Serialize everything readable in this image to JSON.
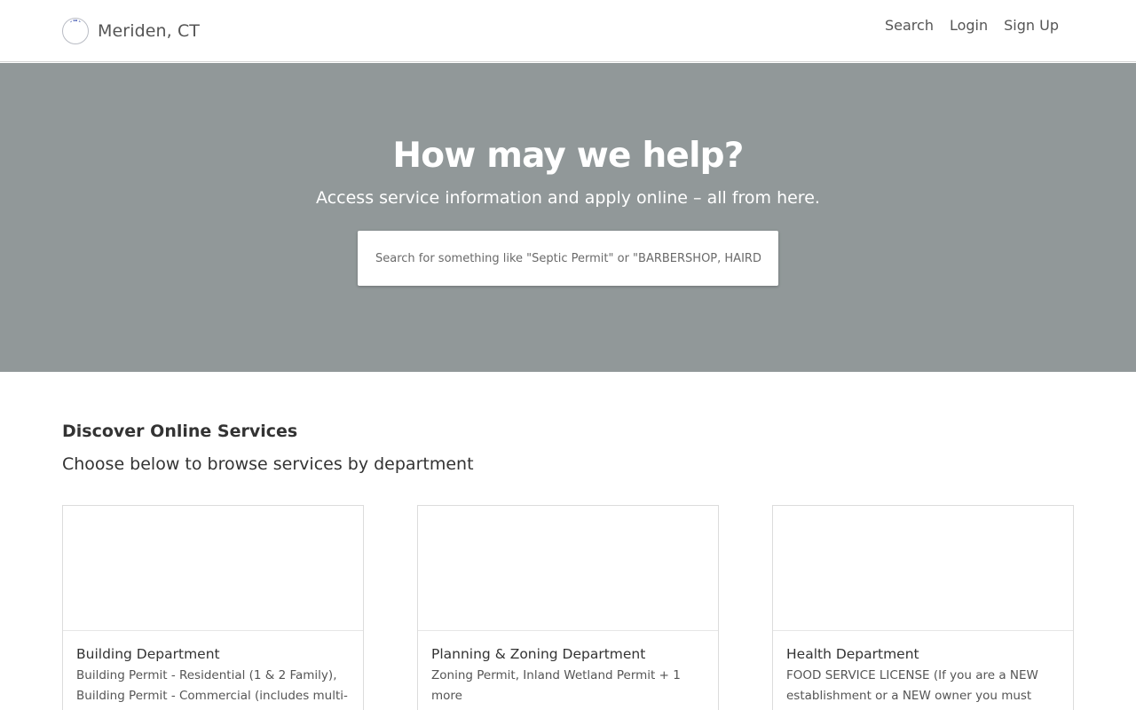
{
  "header": {
    "city_name": "Meriden, CT",
    "logo_icon": "city-seal-icon",
    "nav": {
      "search": "Search",
      "login": "Login",
      "signup": "Sign Up"
    }
  },
  "hero": {
    "title": "How may we help?",
    "subtitle": "Access service information and apply online – all from here.",
    "search_placeholder": "Search for something like \"Septic Permit\" or \"BARBERSHOP, HAIRDR...",
    "search_value": "",
    "background_color": "#919899"
  },
  "discover": {
    "title": "Discover Online Services",
    "subtitle": "Choose below to browse services by department"
  },
  "departments": [
    {
      "name": "Building Department",
      "services": "Building Permit - Residential (1 & 2 Family), Building Permit - Commercial (includes multi-"
    },
    {
      "name": "Planning & Zoning Department",
      "services": "Zoning Permit, Inland Wetland Permit + 1 more"
    },
    {
      "name": "Health Department",
      "services": "FOOD SERVICE LICENSE (If you are a NEW establishment or a NEW owner you must ALSO"
    }
  ]
}
